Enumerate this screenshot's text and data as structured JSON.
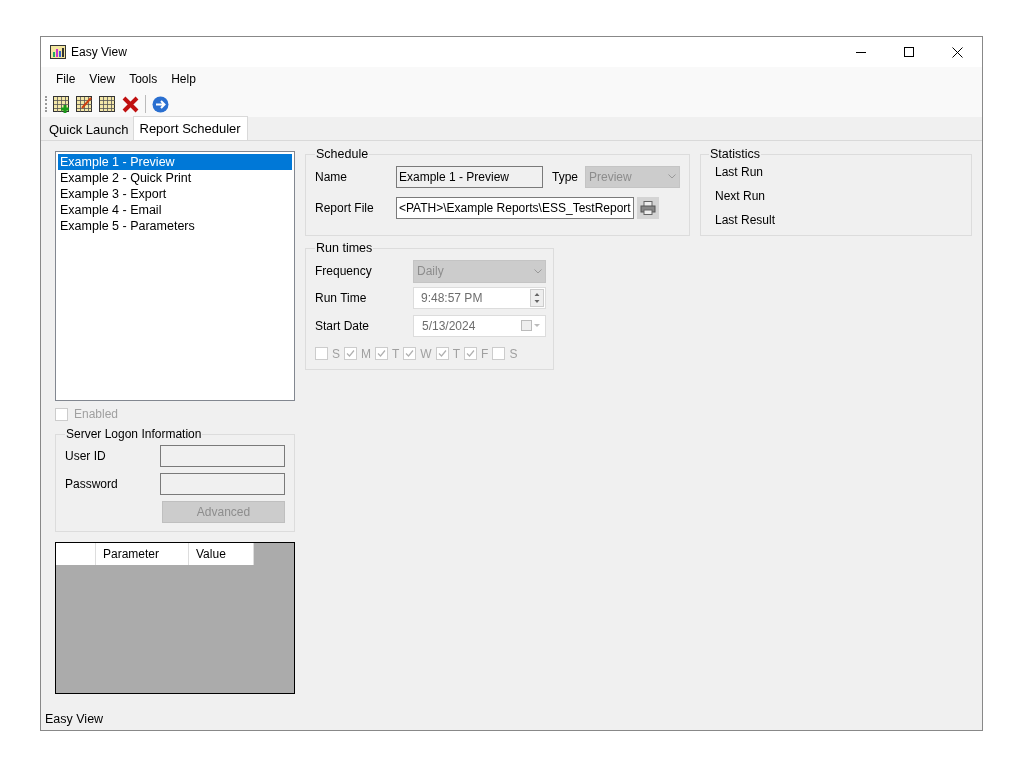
{
  "window": {
    "title": "Easy View"
  },
  "menu": [
    "File",
    "View",
    "Tools",
    "Help"
  ],
  "tabs": [
    {
      "label": "Quick Launch",
      "selected": false
    },
    {
      "label": "Report Scheduler",
      "selected": true
    }
  ],
  "reports": [
    {
      "label": "Example 1 - Preview",
      "selected": true
    },
    {
      "label": "Example 2 - Quick Print",
      "selected": false
    },
    {
      "label": "Example 3 - Export",
      "selected": false
    },
    {
      "label": "Example 4 - Email",
      "selected": false
    },
    {
      "label": "Example 5 - Parameters",
      "selected": false
    }
  ],
  "enabled": {
    "label": "Enabled",
    "checked": false,
    "disabled": true
  },
  "server_logon": {
    "title": "Server Logon Information",
    "user_id_label": "User ID",
    "password_label": "Password",
    "advanced_button": "Advanced"
  },
  "parameters_table": {
    "columns": [
      "Parameter",
      "Value"
    ]
  },
  "schedule": {
    "title": "Schedule",
    "name_label": "Name",
    "name_value": "Example 1 - Preview",
    "type_label": "Type",
    "type_value": "Preview",
    "report_file_label": "Report File",
    "report_file_value": "<PATH>\\Example Reports\\ESS_TestReport"
  },
  "run_times": {
    "title": "Run times",
    "frequency_label": "Frequency",
    "frequency_value": "Daily",
    "run_time_label": "Run Time",
    "run_time_value": "9:48:57 PM",
    "start_date_label": "Start Date",
    "start_date_value": "5/13/2024",
    "days": [
      {
        "label": "S",
        "checked": false
      },
      {
        "label": "M",
        "checked": true
      },
      {
        "label": "T",
        "checked": true
      },
      {
        "label": "W",
        "checked": true
      },
      {
        "label": "T",
        "checked": true
      },
      {
        "label": "F",
        "checked": true
      },
      {
        "label": "S",
        "checked": false
      }
    ]
  },
  "statistics": {
    "title": "Statistics",
    "items": [
      "Last Run",
      "Next Run",
      "Last Result"
    ]
  },
  "status_bar": "Easy View"
}
